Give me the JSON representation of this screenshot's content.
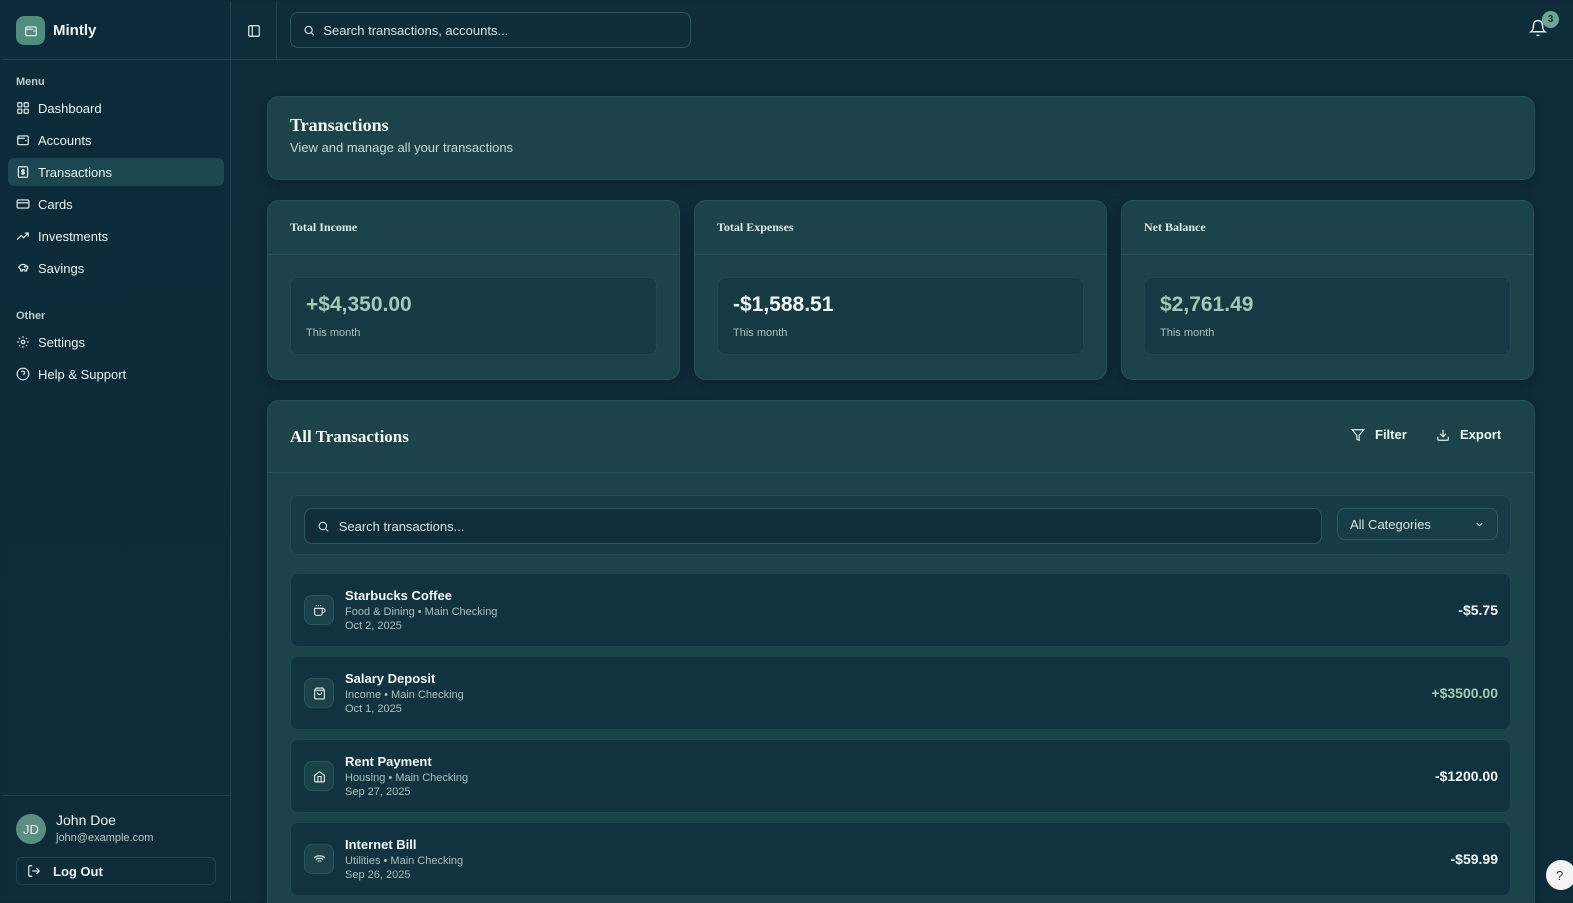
{
  "app": {
    "name": "Mintly"
  },
  "colors": {
    "accent": "#6fa596",
    "income": "#9fcab8",
    "balance": "#9fcab8",
    "expense": "#f3f7f6"
  },
  "sidebar": {
    "menu_label": "Menu",
    "menu_items": [
      {
        "label": "Dashboard",
        "icon": "dashboard-icon"
      },
      {
        "label": "Accounts",
        "icon": "wallet-icon"
      },
      {
        "label": "Transactions",
        "icon": "receipt-icon",
        "active": true
      },
      {
        "label": "Cards",
        "icon": "credit-card-icon"
      },
      {
        "label": "Investments",
        "icon": "trending-up-icon"
      },
      {
        "label": "Savings",
        "icon": "piggy-bank-icon"
      }
    ],
    "other_label": "Other",
    "other_items": [
      {
        "label": "Settings",
        "icon": "gear-icon"
      },
      {
        "label": "Help & Support",
        "icon": "help-circle-icon"
      }
    ]
  },
  "user": {
    "initials": "JD",
    "name": "John Doe",
    "email": "john@example.com",
    "logout_label": "Log Out"
  },
  "header": {
    "search_placeholder": "Search transactions, accounts...",
    "notification_count": "3"
  },
  "page": {
    "title": "Transactions",
    "subtitle": "View and manage all your transactions"
  },
  "stats": [
    {
      "label": "Total Income",
      "value": "+$4,350.00",
      "note": "This month"
    },
    {
      "label": "Total Expenses",
      "value": "-$1,588.51",
      "note": "This month"
    },
    {
      "label": "Net Balance",
      "value": "$2,761.49",
      "note": "This month"
    }
  ],
  "transactions_panel": {
    "title": "All Transactions",
    "filter_label": "Filter",
    "export_label": "Export",
    "search_placeholder": "Search transactions...",
    "category_selected": "All Categories"
  },
  "transactions": [
    {
      "name": "Starbucks Coffee",
      "meta": "Food & Dining • Main Checking",
      "date": "Oct 2, 2025",
      "amount": "-$5.75",
      "icon": "coffee-icon"
    },
    {
      "name": "Salary Deposit",
      "meta": "Income • Main Checking",
      "date": "Oct 1, 2025",
      "amount": "+$3500.00",
      "icon": "shopping-bag-icon"
    },
    {
      "name": "Rent Payment",
      "meta": "Housing • Main Checking",
      "date": "Sep 27, 2025",
      "amount": "-$1200.00",
      "icon": "home-icon"
    },
    {
      "name": "Internet Bill",
      "meta": "Utilities • Main Checking",
      "date": "Sep 26, 2025",
      "amount": "-$59.99",
      "icon": "wifi-icon"
    }
  ],
  "help_fab": "?"
}
